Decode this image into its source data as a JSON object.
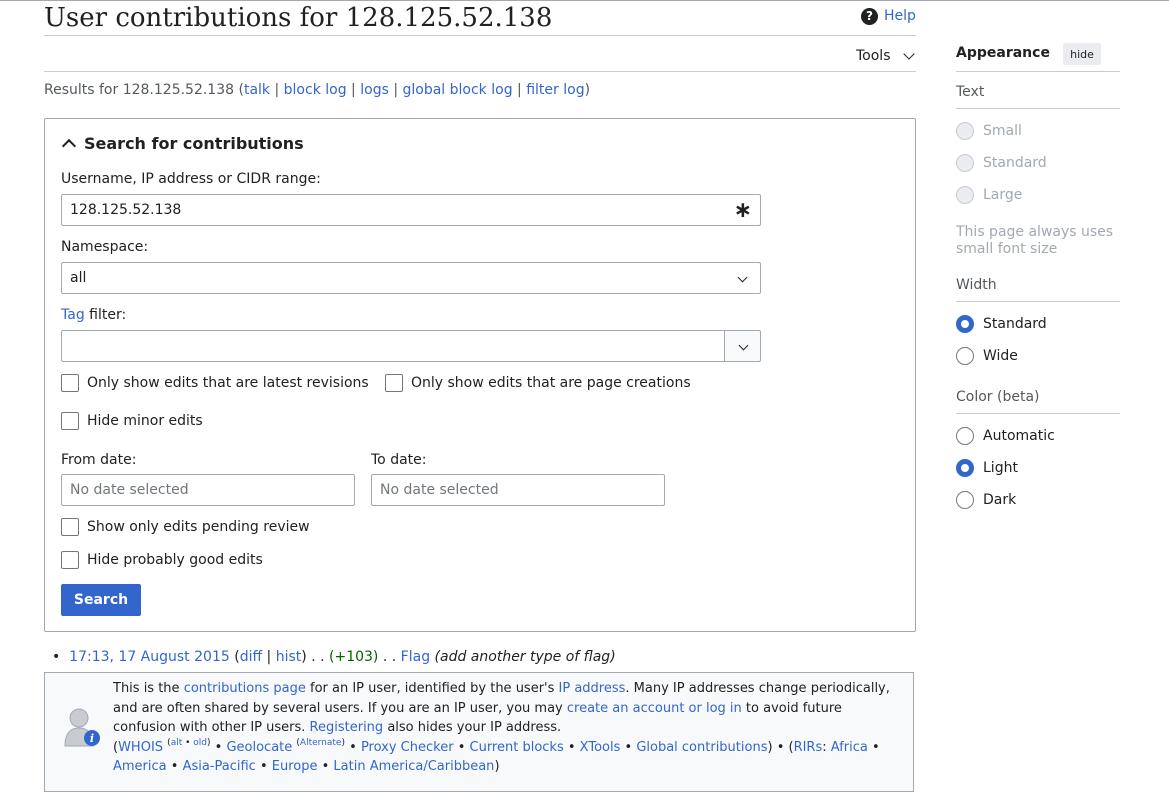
{
  "header": {
    "title": "User contributions for 128.125.52.138",
    "help_label": "Help",
    "tools_label": "Tools"
  },
  "results": {
    "prefix": "Results for 128.125.52.138 (",
    "talk": "talk",
    "block_log": "block log",
    "logs": "logs",
    "global_block_log": "global block log",
    "filter_log": "filter log",
    "suffix": ")"
  },
  "search": {
    "legend": "Search for contributions",
    "user_label": "Username, IP address or CIDR range:",
    "user_value": "128.125.52.138",
    "namespace_label": "Namespace:",
    "namespace_value": "all",
    "tag_link": "Tag",
    "tag_label_rest": " filter:",
    "cb_latest": "Only show edits that are latest revisions",
    "cb_creations": "Only show edits that are page creations",
    "cb_minor": "Hide minor edits",
    "from_label": "From date:",
    "to_label": "To date:",
    "from_placeholder": "No date selected",
    "to_placeholder": "No date selected",
    "cb_pending": "Show only edits pending review",
    "cb_good": "Hide probably good edits",
    "search_button": "Search"
  },
  "contribution": {
    "timestamp": "17:13, 17 August 2015",
    "diff": "diff",
    "hist": "hist",
    "dots1": " . . ",
    "size_change": "(+103)",
    "dots2": " . . ",
    "page": "Flag",
    "summary": "(add another type of flag)"
  },
  "ip_info": {
    "t1": "This is the ",
    "contributions_page": "contributions page",
    "t2": " for an IP user, identified by the user's ",
    "ip_address": "IP address",
    "t3": ". Many IP addresses change periodically, and are often shared by several users. If you are an IP user, you may ",
    "create_account": "create an account or log in",
    "t4": " to avoid future confusion with other IP users. ",
    "registering": "Registering",
    "t5": " also hides your IP address.",
    "whois": "WHOIS",
    "alt": "alt",
    "old": "old",
    "geolocate": "Geolocate",
    "alternate": "Alternate",
    "proxy_checker": "Proxy Checker",
    "current_blocks": "Current blocks",
    "xtools": "XTools",
    "global_contributions": "Global contributions",
    "rirs": "RIRs",
    "africa": "Africa",
    "america": "America",
    "asia_pacific": "Asia-Pacific",
    "europe": "Europe",
    "latin_america": "Latin America/Caribbean"
  },
  "appearance": {
    "title": "Appearance",
    "hide": "hide",
    "text_heading": "Text",
    "text_options": [
      "Small",
      "Standard",
      "Large"
    ],
    "text_note": "This page always uses small font size",
    "width_heading": "Width",
    "width_options": [
      "Standard",
      "Wide"
    ],
    "width_selected": "Standard",
    "color_heading": "Color (beta)",
    "color_options": [
      "Automatic",
      "Light",
      "Dark"
    ],
    "color_selected": "Light"
  },
  "colors": {
    "link": "#3366cc",
    "positive_change": "#006400",
    "button_primary": "#3366cc"
  }
}
